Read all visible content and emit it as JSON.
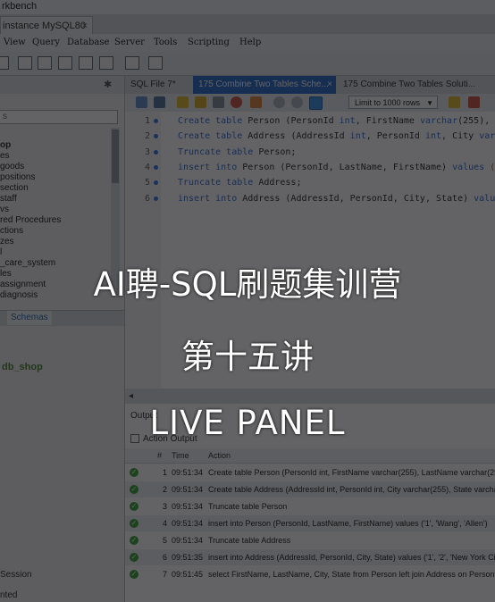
{
  "window": {
    "title": "rkbench",
    "connection_tab": "instance MySQL80",
    "close_glyph": "×"
  },
  "menu": [
    "View",
    "Query",
    "Database",
    "Server",
    "Tools",
    "Scripting",
    "Help"
  ],
  "sidebar": {
    "search_placeholder": "s",
    "tree": [
      "op",
      "es",
      "goods",
      "positions",
      "section",
      "staff",
      "vs",
      "red Procedures",
      "ctions",
      "zes",
      "l",
      "_care_system",
      "les",
      "assignment",
      "diagnosis"
    ],
    "selected_index": 0,
    "tab_label": "Schemas",
    "db_label": "db_shop",
    "session_label": "Session",
    "bottom_label": "nted"
  },
  "editor": {
    "tabs": [
      {
        "label": "SQL File 7*",
        "active": false
      },
      {
        "label": "175 Combine Two Tables Sche...",
        "active": true
      },
      {
        "label": "175 Combine Two Tables Soluti...",
        "active": false
      }
    ],
    "limit_label": "Limit to 1000 rows",
    "lines": [
      {
        "n": "1",
        "parts": [
          [
            "kw",
            "Create table "
          ],
          [
            "",
            "Person (PersonId "
          ],
          [
            "kw",
            "int"
          ],
          [
            "",
            ", FirstName "
          ],
          [
            "kw",
            "varchar"
          ],
          [
            "",
            "(255), Las"
          ]
        ]
      },
      {
        "n": "2",
        "parts": [
          [
            "kw",
            "Create table "
          ],
          [
            "",
            "Address (AddressId "
          ],
          [
            "kw",
            "int"
          ],
          [
            "",
            ", PersonId "
          ],
          [
            "kw",
            "int"
          ],
          [
            "",
            ", City "
          ],
          [
            "kw",
            "varcha"
          ]
        ]
      },
      {
        "n": "3",
        "parts": [
          [
            "kw",
            "Truncate table "
          ],
          [
            "",
            "Person;"
          ]
        ]
      },
      {
        "n": "4",
        "parts": [
          [
            "kw",
            "insert into "
          ],
          [
            "",
            "Person (PersonId, LastName, FirstName) "
          ],
          [
            "kw",
            "values "
          ],
          [
            "str",
            "('1'"
          ]
        ]
      },
      {
        "n": "5",
        "parts": [
          [
            "kw",
            "Truncate table "
          ],
          [
            "",
            "Address;"
          ]
        ]
      },
      {
        "n": "6",
        "parts": [
          [
            "kw",
            "insert into "
          ],
          [
            "",
            "Address (AddressId, PersonId, City, State) "
          ],
          [
            "kw",
            "values "
          ],
          [
            "str",
            "("
          ]
        ]
      }
    ]
  },
  "output": {
    "panel_label": "Output",
    "action_output_label": "Action Output",
    "columns": {
      "num": "#",
      "time": "Time",
      "action": "Action"
    },
    "rows": [
      {
        "num": "1",
        "time": "09:51:34",
        "action": "Create table Person (PersonId int, FirstName varchar(255), LastName varchar(255))"
      },
      {
        "num": "2",
        "time": "09:51:34",
        "action": "Create table Address (AddressId int, PersonId int, City varchar(255), State varchar(2"
      },
      {
        "num": "3",
        "time": "09:51:34",
        "action": "Truncate table Person"
      },
      {
        "num": "4",
        "time": "09:51:34",
        "action": "insert into Person (PersonId, LastName, FirstName) values ('1', 'Wang', 'Allen')"
      },
      {
        "num": "5",
        "time": "09:51:34",
        "action": "Truncate table Address"
      },
      {
        "num": "6",
        "time": "09:51:35",
        "action": "insert into Address (AddressId, PersonId, City, State) values ('1', '2', 'New York City',"
      },
      {
        "num": "7",
        "time": "09:51:45",
        "action": "select FirstName, LastName, City, State from Person left join Address on Person.Per"
      }
    ]
  },
  "banner": {
    "line1": "AI聘-SQL刷题集训营",
    "line2": "第十五讲",
    "line3": "LIVE PANEL"
  },
  "colors": {
    "keyword": "#2a63c9",
    "active_tab": "#1e64c8",
    "ok_status": "#2fa12f",
    "db_label": "#3e7d25",
    "overlay": "rgba(18,18,22,0.66)"
  }
}
